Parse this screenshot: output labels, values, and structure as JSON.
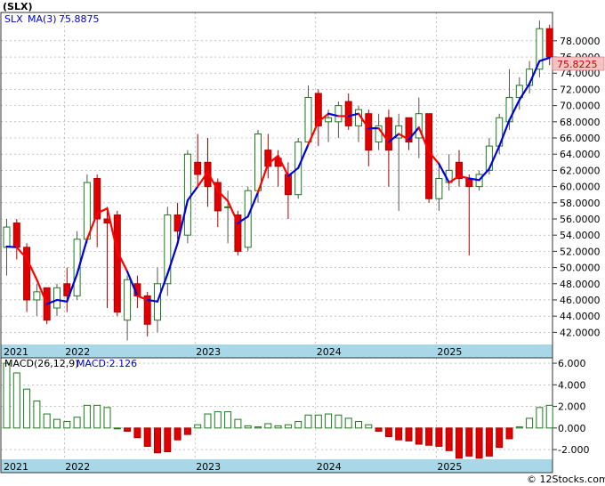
{
  "header": {
    "symbol_title": "(SLX)",
    "legend_symbol": "SLX",
    "legend_ma_label": "MA(3)",
    "legend_ma_value": "75.8875",
    "last_price_badge": "75.8225",
    "macd_label": "MACD(26,12,9)",
    "macd_value_label": "MACD:2.126",
    "watermark": "© 12Stocks.com"
  },
  "colors": {
    "up": "#1a7a1a",
    "down": "#e00000",
    "ma_above": "#0000dd",
    "ma_below": "#ff0000",
    "axis_band": "#a8d8e8",
    "badge_bg": "#f4c4c4",
    "badge_text": "#cc0000"
  },
  "chart_data": [
    {
      "type": "candlestick",
      "title": "(SLX)",
      "ylim": [
        40.5,
        81.5
      ],
      "y_ticks": [
        "42.0000",
        "44.0000",
        "46.0000",
        "48.0000",
        "50.0000",
        "52.0000",
        "54.0000",
        "56.0000",
        "58.0000",
        "60.0000",
        "62.0000",
        "64.0000",
        "66.0000",
        "68.0000",
        "70.0000",
        "72.0000",
        "74.0000",
        "76.0000",
        "78.0000"
      ],
      "x_tick_labels": [
        "2021",
        "2022",
        "2023",
        "2024",
        "2025"
      ],
      "grid": true,
      "candles": [
        {
          "o": 52.5,
          "h": 56.0,
          "l": 49.0,
          "c": 55.0
        },
        {
          "o": 55.5,
          "h": 56.0,
          "l": 51.0,
          "c": 52.5
        },
        {
          "o": 52.5,
          "h": 53.0,
          "l": 44.5,
          "c": 46.0
        },
        {
          "o": 46.0,
          "h": 48.0,
          "l": 44.0,
          "c": 47.0
        },
        {
          "o": 47.5,
          "h": 47.5,
          "l": 43.0,
          "c": 43.5
        },
        {
          "o": 45.0,
          "h": 48.0,
          "l": 44.0,
          "c": 47.5
        },
        {
          "o": 48.0,
          "h": 50.0,
          "l": 44.5,
          "c": 46.5
        },
        {
          "o": 46.5,
          "h": 54.5,
          "l": 46.0,
          "c": 53.5
        },
        {
          "o": 53.5,
          "h": 61.5,
          "l": 53.0,
          "c": 60.5
        },
        {
          "o": 61.0,
          "h": 61.5,
          "l": 52.5,
          "c": 56.0
        },
        {
          "o": 56.0,
          "h": 57.5,
          "l": 45.0,
          "c": 55.5
        },
        {
          "o": 56.5,
          "h": 57.0,
          "l": 44.0,
          "c": 44.5
        },
        {
          "o": 43.5,
          "h": 49.0,
          "l": 41.0,
          "c": 48.5
        },
        {
          "o": 48.0,
          "h": 49.0,
          "l": 45.0,
          "c": 46.5
        },
        {
          "o": 46.5,
          "h": 47.0,
          "l": 41.5,
          "c": 43.0
        },
        {
          "o": 43.5,
          "h": 50.0,
          "l": 42.0,
          "c": 48.0
        },
        {
          "o": 48.0,
          "h": 57.5,
          "l": 46.5,
          "c": 56.5
        },
        {
          "o": 56.5,
          "h": 58.0,
          "l": 53.5,
          "c": 54.5
        },
        {
          "o": 54.0,
          "h": 64.5,
          "l": 53.0,
          "c": 64.0
        },
        {
          "o": 63.0,
          "h": 66.5,
          "l": 60.0,
          "c": 61.5
        },
        {
          "o": 63.0,
          "h": 66.0,
          "l": 57.5,
          "c": 60.0
        },
        {
          "o": 60.5,
          "h": 61.0,
          "l": 55.0,
          "c": 57.0
        },
        {
          "o": 57.5,
          "h": 59.5,
          "l": 53.0,
          "c": 57.5
        },
        {
          "o": 56.5,
          "h": 57.0,
          "l": 51.5,
          "c": 52.0
        },
        {
          "o": 52.5,
          "h": 60.0,
          "l": 52.0,
          "c": 59.5
        },
        {
          "o": 59.5,
          "h": 67.0,
          "l": 58.0,
          "c": 66.5
        },
        {
          "o": 64.5,
          "h": 66.5,
          "l": 61.0,
          "c": 62.5
        },
        {
          "o": 63.5,
          "h": 64.5,
          "l": 60.0,
          "c": 62.5
        },
        {
          "o": 61.5,
          "h": 63.0,
          "l": 56.0,
          "c": 59.0
        },
        {
          "o": 59.0,
          "h": 66.0,
          "l": 58.5,
          "c": 65.5
        },
        {
          "o": 65.5,
          "h": 72.5,
          "l": 65.0,
          "c": 71.0
        },
        {
          "o": 71.5,
          "h": 72.0,
          "l": 65.0,
          "c": 67.5
        },
        {
          "o": 68.0,
          "h": 69.5,
          "l": 65.5,
          "c": 68.5
        },
        {
          "o": 68.0,
          "h": 70.5,
          "l": 66.0,
          "c": 70.0
        },
        {
          "o": 70.5,
          "h": 71.5,
          "l": 67.0,
          "c": 67.5
        },
        {
          "o": 67.5,
          "h": 70.0,
          "l": 65.5,
          "c": 69.5
        },
        {
          "o": 69.0,
          "h": 69.5,
          "l": 62.5,
          "c": 64.5
        },
        {
          "o": 65.5,
          "h": 69.0,
          "l": 64.5,
          "c": 67.5
        },
        {
          "o": 68.5,
          "h": 69.5,
          "l": 60.0,
          "c": 64.5
        },
        {
          "o": 66.0,
          "h": 69.0,
          "l": 57.0,
          "c": 67.5
        },
        {
          "o": 68.5,
          "h": 68.5,
          "l": 64.5,
          "c": 65.5
        },
        {
          "o": 66.0,
          "h": 71.0,
          "l": 63.5,
          "c": 69.0
        },
        {
          "o": 69.0,
          "h": 69.0,
          "l": 58.0,
          "c": 58.5
        },
        {
          "o": 58.5,
          "h": 63.0,
          "l": 57.0,
          "c": 61.0
        },
        {
          "o": 60.5,
          "h": 64.0,
          "l": 59.5,
          "c": 62.0
        },
        {
          "o": 63.0,
          "h": 64.5,
          "l": 60.0,
          "c": 61.0
        },
        {
          "o": 61.0,
          "h": 61.5,
          "l": 51.5,
          "c": 60.0
        },
        {
          "o": 60.0,
          "h": 62.0,
          "l": 59.5,
          "c": 61.5
        },
        {
          "o": 62.0,
          "h": 66.0,
          "l": 61.5,
          "c": 65.0
        },
        {
          "o": 65.0,
          "h": 69.0,
          "l": 64.0,
          "c": 68.5
        },
        {
          "o": 68.0,
          "h": 74.5,
          "l": 67.0,
          "c": 71.0
        },
        {
          "o": 71.0,
          "h": 73.5,
          "l": 69.5,
          "c": 72.5
        },
        {
          "o": 72.5,
          "h": 75.5,
          "l": 71.5,
          "c": 74.5
        },
        {
          "o": 74.5,
          "h": 80.5,
          "l": 73.5,
          "c": 79.5
        },
        {
          "o": 79.5,
          "h": 80.0,
          "l": 75.0,
          "c": 76.0
        }
      ],
      "ma3": [
        52.6,
        52.5,
        51.1,
        48.5,
        45.5,
        46.0,
        45.8,
        49.2,
        53.5,
        56.7,
        57.3,
        52.0,
        49.5,
        46.5,
        46.0,
        45.8,
        49.2,
        53.0,
        58.3,
        60.0,
        61.8,
        59.5,
        58.2,
        55.5,
        56.3,
        59.3,
        62.8,
        63.8,
        61.3,
        62.3,
        65.2,
        68.0,
        69.0,
        68.7,
        68.7,
        69.0,
        67.2,
        67.2,
        65.5,
        66.5,
        65.8,
        67.3,
        64.3,
        62.8,
        60.5,
        61.3,
        61.0,
        60.8,
        62.2,
        65.0,
        68.2,
        70.7,
        72.7,
        75.5,
        75.9
      ]
    },
    {
      "type": "bar",
      "title": "MACD(26,12,9)",
      "ylim": [
        -2.9,
        6.5
      ],
      "y_ticks": [
        "-2.000",
        "0.000",
        "2.000",
        "4.000",
        "6.000"
      ],
      "x_tick_labels": [
        "2021",
        "2022",
        "2023",
        "2024",
        "2025"
      ],
      "values": [
        6.0,
        5.1,
        3.6,
        2.5,
        1.3,
        0.8,
        0.6,
        1.0,
        2.1,
        2.1,
        1.9,
        0.0,
        -0.3,
        -0.9,
        -1.7,
        -2.3,
        -2.2,
        -1.1,
        -0.6,
        0.3,
        1.3,
        1.5,
        1.5,
        0.8,
        0.2,
        0.1,
        0.4,
        0.2,
        0.3,
        0.6,
        1.2,
        1.2,
        1.3,
        1.2,
        0.9,
        0.6,
        0.3,
        -0.3,
        -0.8,
        -1.1,
        -1.2,
        -1.5,
        -1.6,
        -1.7,
        -2.1,
        -2.8,
        -2.6,
        -2.8,
        -2.6,
        -1.8,
        -1.0,
        0.1,
        0.9,
        1.9,
        2.1
      ]
    }
  ]
}
